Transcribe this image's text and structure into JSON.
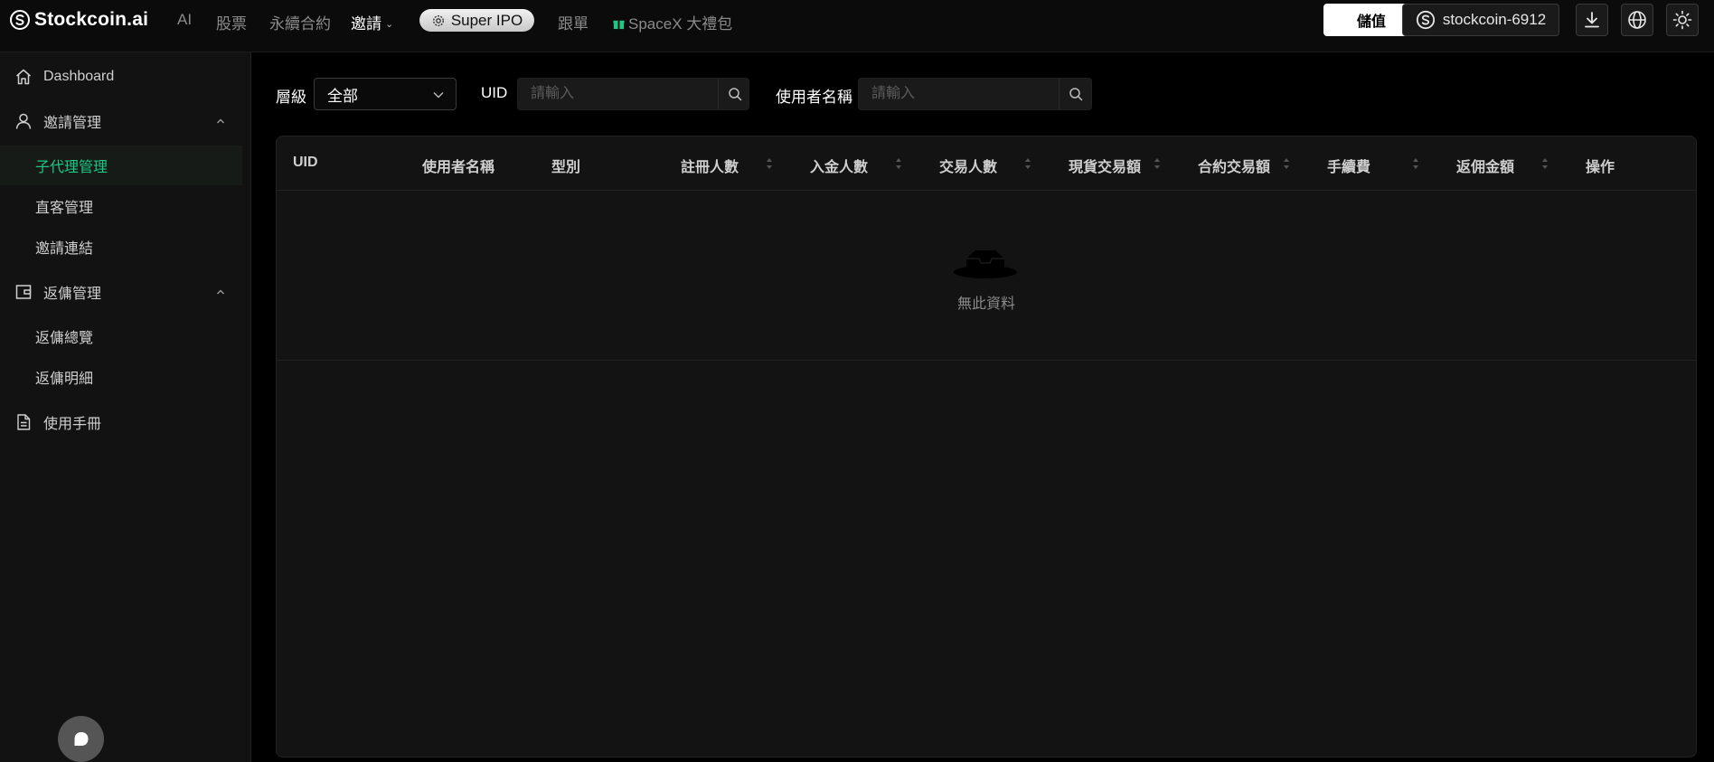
{
  "header": {
    "logo_text": "Stockcoin.ai",
    "nav": [
      {
        "label": "AI"
      },
      {
        "label": "股票"
      },
      {
        "label": "永續合約"
      },
      {
        "label": "邀請"
      },
      {
        "label": "Super IPO"
      },
      {
        "label": "跟單"
      },
      {
        "label": "SpaceX 大禮包"
      }
    ],
    "deposit_label": "儲值",
    "user_label": "stockcoin-6912",
    "icons": [
      "download-icon",
      "globe-icon",
      "sun-icon"
    ]
  },
  "sidebar": {
    "items": [
      {
        "label": "Dashboard",
        "icon": "home-icon"
      },
      {
        "label": "邀請管理",
        "icon": "user-icon"
      },
      {
        "label": "子代理管理"
      },
      {
        "label": "直客管理"
      },
      {
        "label": "邀請連結"
      },
      {
        "label": "返傭管理",
        "icon": "wallet-icon"
      },
      {
        "label": "返傭總覽"
      },
      {
        "label": "返傭明細"
      },
      {
        "label": "使用手冊",
        "icon": "document-icon"
      }
    ],
    "active_item": "子代理管理",
    "accent_color": "#1ec784"
  },
  "filters": {
    "level_label": "層級",
    "level_value": "全部",
    "uid_label": "UID",
    "uid_placeholder": "請輸入",
    "username_label": "使用者名稱",
    "username_placeholder": "請輸入"
  },
  "table": {
    "columns": [
      "UID",
      "使用者名稱",
      "型別",
      "註冊人數",
      "入金人數",
      "交易人數",
      "現貨交易額",
      "合約交易額",
      "手續費",
      "返佣金額",
      "操作"
    ],
    "sortable_columns": [
      "註冊人數",
      "入金人數",
      "交易人數",
      "現貨交易額",
      "合約交易額",
      "手續費",
      "返佣金額"
    ],
    "rows": [],
    "empty_text": "無此資料"
  }
}
